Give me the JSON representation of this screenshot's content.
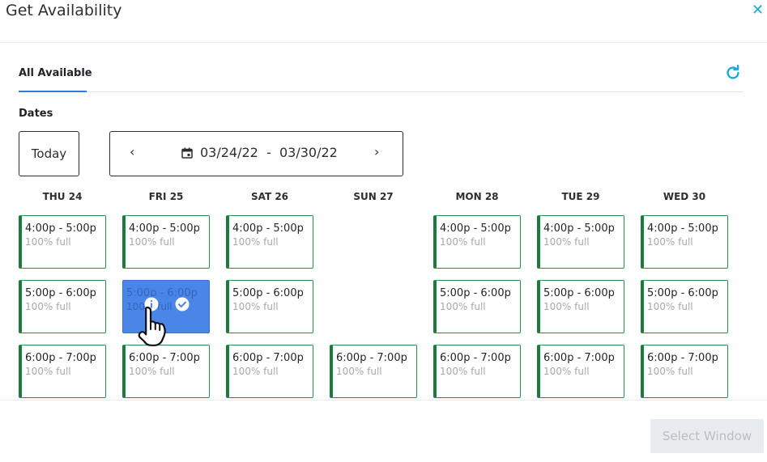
{
  "dialog": {
    "title": "Get Availability",
    "close_icon": "close-icon",
    "accent_color": "#1ba9d6"
  },
  "tabs": [
    {
      "label": "All Available",
      "active": true
    }
  ],
  "dates": {
    "label": "Dates",
    "today_label": "Today",
    "range_start": "03/24/22",
    "range_separator": "-",
    "range_end": "03/30/22"
  },
  "days": [
    {
      "label": "THU 24",
      "slots": [
        {
          "time": "4:00p - 5:00p",
          "capacity": "100% full"
        },
        {
          "time": "5:00p - 6:00p",
          "capacity": "100% full"
        },
        {
          "time": "6:00p - 7:00p",
          "capacity": "100% full"
        }
      ]
    },
    {
      "label": "FRI 25",
      "slots": [
        {
          "time": "4:00p - 5:00p",
          "capacity": "100% full"
        },
        {
          "time": "5:00p - 6:00p",
          "capacity": "100% full",
          "selected": true
        },
        {
          "time": "6:00p - 7:00p",
          "capacity": "100% full"
        }
      ]
    },
    {
      "label": "SAT 26",
      "slots": [
        {
          "time": "4:00p - 5:00p",
          "capacity": "100% full"
        },
        {
          "time": "5:00p - 6:00p",
          "capacity": "100% full"
        },
        {
          "time": "6:00p - 7:00p",
          "capacity": "100% full"
        }
      ]
    },
    {
      "label": "SUN 27",
      "slots": [
        {
          "time": "6:00p - 7:00p",
          "capacity": "100% full"
        }
      ]
    },
    {
      "label": "MON 28",
      "slots": [
        {
          "time": "4:00p - 5:00p",
          "capacity": "100% full"
        },
        {
          "time": "5:00p - 6:00p",
          "capacity": "100% full"
        },
        {
          "time": "6:00p - 7:00p",
          "capacity": "100% full"
        }
      ]
    },
    {
      "label": "TUE 29",
      "slots": [
        {
          "time": "4:00p - 5:00p",
          "capacity": "100% full"
        },
        {
          "time": "5:00p - 6:00p",
          "capacity": "100% full"
        },
        {
          "time": "6:00p - 7:00p",
          "capacity": "100% full"
        }
      ]
    },
    {
      "label": "WED 30",
      "slots": [
        {
          "time": "4:00p - 5:00p",
          "capacity": "100% full"
        },
        {
          "time": "5:00p - 6:00p",
          "capacity": "100% full"
        },
        {
          "time": "6:00p - 7:00p",
          "capacity": "100% full"
        }
      ]
    }
  ],
  "footer": {
    "select_label": "Select Window",
    "select_enabled": false
  },
  "colors": {
    "slot_border": "#1f7a3f",
    "selected_fill": "#4a86e8",
    "tab_underline": "#2f7be0"
  }
}
